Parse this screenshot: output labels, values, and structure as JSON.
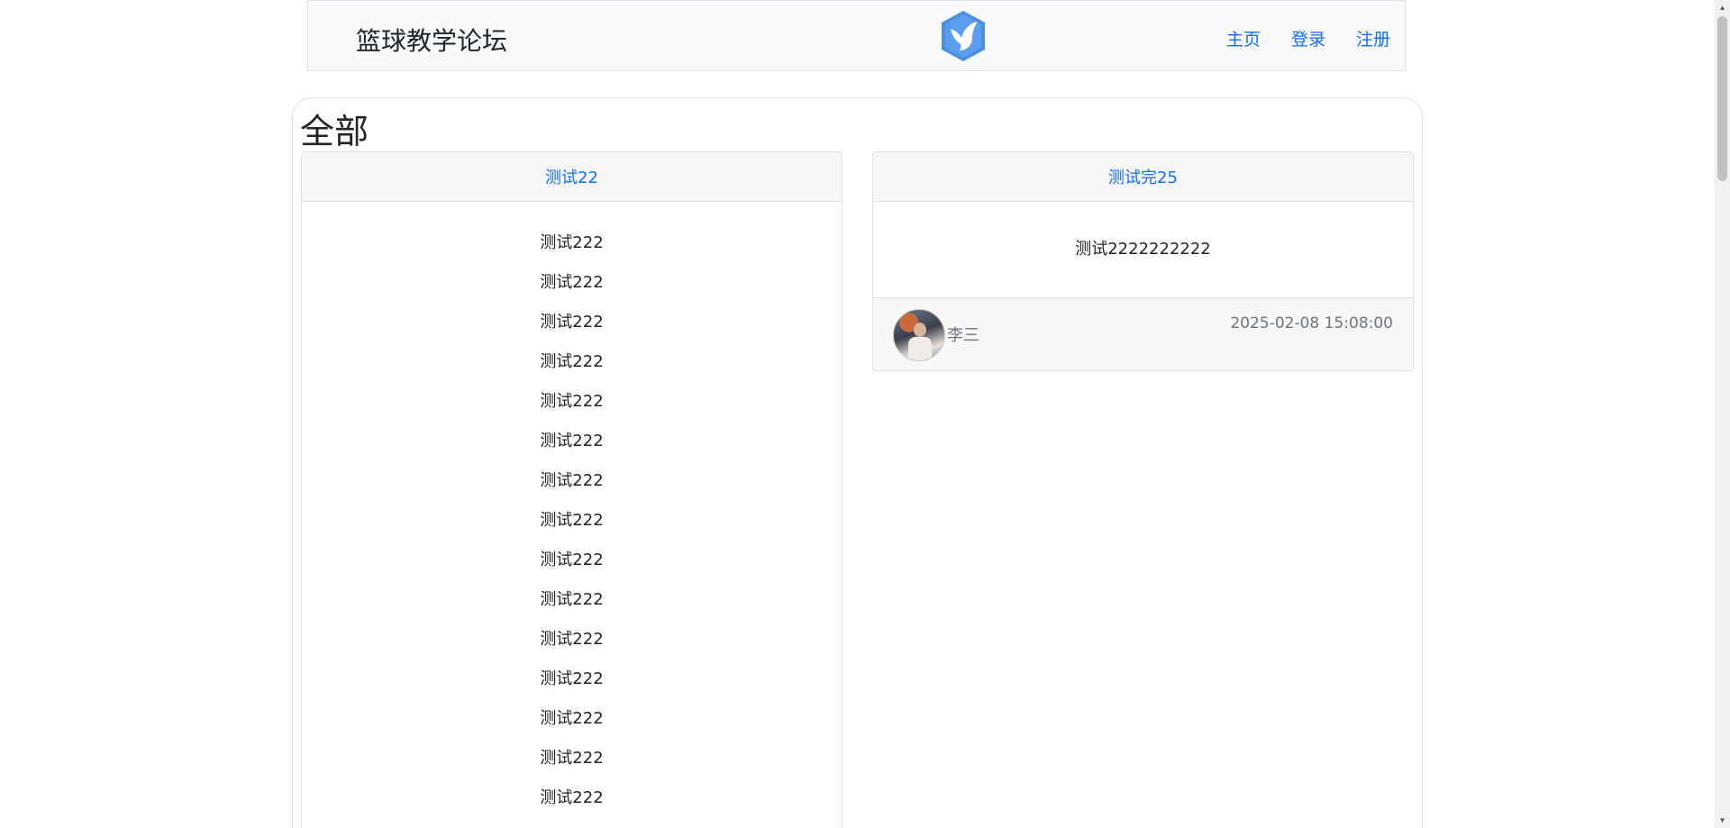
{
  "navbar": {
    "brand": "篮球教学论坛",
    "logo_icon": "bird-hexagon-logo",
    "links": [
      {
        "label": "主页"
      },
      {
        "label": "登录"
      },
      {
        "label": "注册"
      }
    ]
  },
  "section": {
    "title": "全部"
  },
  "posts": [
    {
      "title": "测试22",
      "content_lines": [
        "测试222",
        "测试222",
        "测试222",
        "测试222",
        "测试222",
        "测试222",
        "测试222",
        "测试222",
        "测试222",
        "测试222",
        "测试222",
        "测试222",
        "测试222",
        "测试222",
        "测试222"
      ]
    },
    {
      "title": "测试完25",
      "content": "测试2222222222",
      "author": "李三",
      "timestamp": "2025-02-08 15:08:00"
    }
  ],
  "colors": {
    "link": "#0d6efd",
    "logo": "#4a8fe0",
    "header_bg": "#f8f9fa"
  }
}
